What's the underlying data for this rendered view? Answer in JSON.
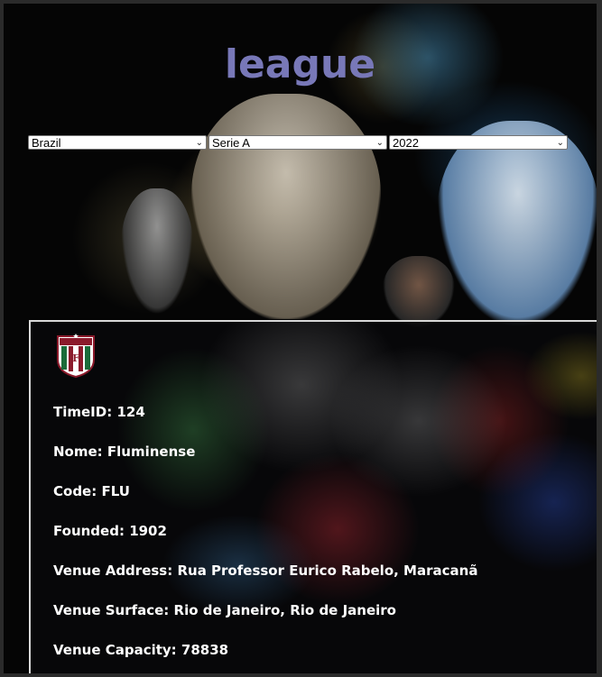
{
  "header": {
    "title": "league"
  },
  "filters": {
    "country": "Brazil",
    "league": "Serie A",
    "season": "2022"
  },
  "team": {
    "crest_icon": "fluminense-crest-icon",
    "rows": [
      {
        "label": "TimeID:",
        "value": "124"
      },
      {
        "label": "Nome:",
        "value": "Fluminense"
      },
      {
        "label": "Code:",
        "value": "FLU"
      },
      {
        "label": "Founded:",
        "value": "1902"
      },
      {
        "label": "Venue Address:",
        "value": "Rua Professor Eurico Rabelo, Maracanã"
      },
      {
        "label": "Venue Surface:",
        "value": "Rio de Janeiro, Rio de Janeiro"
      },
      {
        "label": "Venue Capacity:",
        "value": "78838"
      }
    ]
  },
  "colors": {
    "title": "#7878b8",
    "crest_green": "#1b6b3a",
    "crest_red": "#8b1a2b"
  }
}
